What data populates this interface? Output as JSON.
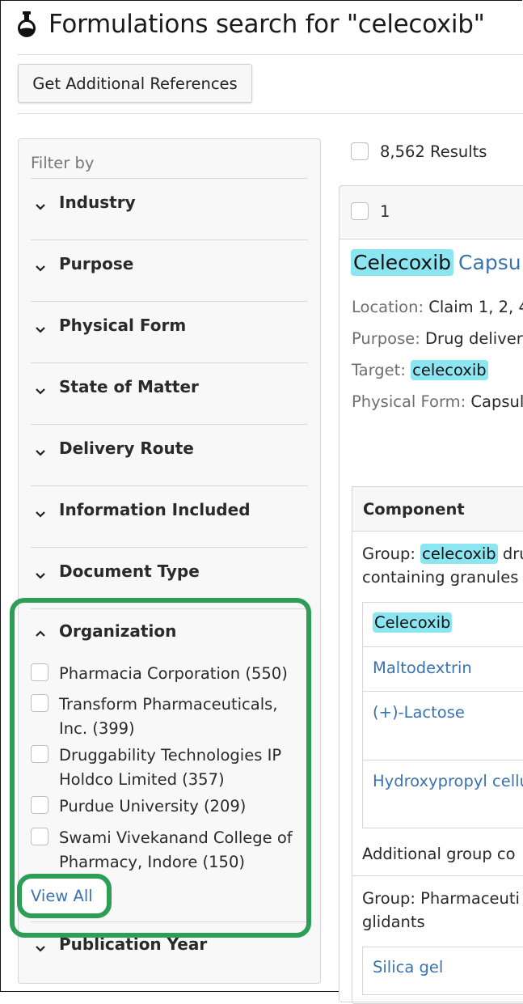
{
  "header": {
    "title": "Formulations search for \"celecoxib\"",
    "icon": "flask-icon",
    "additional_refs_button": "Get Additional References"
  },
  "filters": {
    "heading": "Filter by",
    "facets": [
      "Industry",
      "Purpose",
      "Physical Form",
      "State of Matter",
      "Delivery Route",
      "Information Included",
      "Document Type"
    ],
    "organization": {
      "label": "Organization",
      "items": [
        {
          "label": "Pharmacia Corporation (550)"
        },
        {
          "label": "Transform Pharmaceuticals, Inc. (399)"
        },
        {
          "label": "Druggability Technologies IP Holdco Limited (357)"
        },
        {
          "label": "Purdue University (209)"
        },
        {
          "label": "Swami Vivekanand College of Pharmacy, Indore (150)"
        }
      ],
      "view_all": "View All"
    },
    "publication_year": "Publication Year"
  },
  "results": {
    "count_label": "8,562 Results",
    "first": {
      "number": "1",
      "title_highlight": "Celecoxib",
      "title_rest": "Capsu",
      "location_key": "Location:",
      "location_val": "Claim 1, 2, 4",
      "purpose_key": "Purpose:",
      "purpose_val": "Drug deliver",
      "target_key": "Target:",
      "target_val": "celecoxib",
      "physical_form_key": "Physical Form:",
      "physical_form_val": "Capsul",
      "component_header": "Component",
      "group1_key": "Group:",
      "group1_hl": "celecoxib",
      "group1_rest": "dru",
      "group1_line2": "containing granules",
      "components": [
        "Celecoxib",
        "Maltodextrin",
        "(+)-Lactose",
        "Hydroxypropyl cellu"
      ],
      "additional_group": "Additional group co",
      "group2_line1": "Group: Pharmaceuti",
      "group2_line2": "glidants",
      "group2_components": [
        "Silica gel"
      ]
    }
  },
  "colors": {
    "highlight": "#8ce6f2",
    "link": "#3a73b0",
    "annotation": "#2e9e57"
  }
}
